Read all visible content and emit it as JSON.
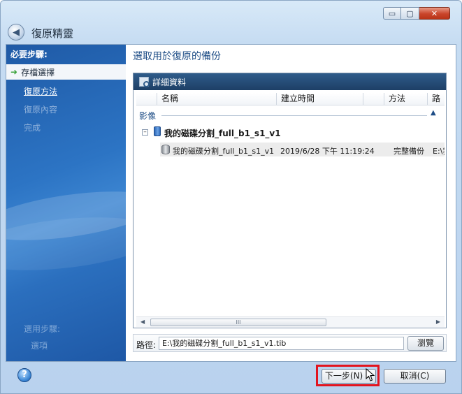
{
  "window": {
    "title": "復原精靈",
    "controls": {
      "minimize": "▭",
      "maximize": "▢",
      "close": "✕"
    }
  },
  "sidebar": {
    "heading": "必要步驟:",
    "current_step": "存檔選擇",
    "steps": [
      {
        "label": "復原方法",
        "state": "link"
      },
      {
        "label": "復原內容",
        "state": "disabled"
      },
      {
        "label": "完成",
        "state": "disabled"
      }
    ],
    "optional_heading": "選用步驟:",
    "optional_step": "選項"
  },
  "main": {
    "title": "選取用於復原的備份",
    "panel_title": "詳細資料",
    "columns": [
      "名稱",
      "建立時間",
      "方法",
      "路"
    ],
    "group_label": "影像",
    "archive": {
      "name": "我的磁碟分割_full_b1_s1_v1"
    },
    "backup_row": {
      "name": "我的磁碟分割_full_b1_s1_v1",
      "created": "2019/6/28 下午 11:19:24",
      "method": "完整備份",
      "path": "E:\\我"
    },
    "scroll": {
      "left": "◀",
      "right": "▶",
      "grip": "III"
    },
    "path_label": "路徑:",
    "path_value": "E:\\我的磁碟分割_full_b1_s1_v1.tib",
    "browse_label": "瀏覽"
  },
  "footer": {
    "help": "?",
    "next_label": "下一步(N) >",
    "cancel_label": "取消(C)"
  },
  "colors": {
    "accent_title": "#1e4d86",
    "sidebar": "#2c74c4",
    "highlight": "#e2141e"
  }
}
